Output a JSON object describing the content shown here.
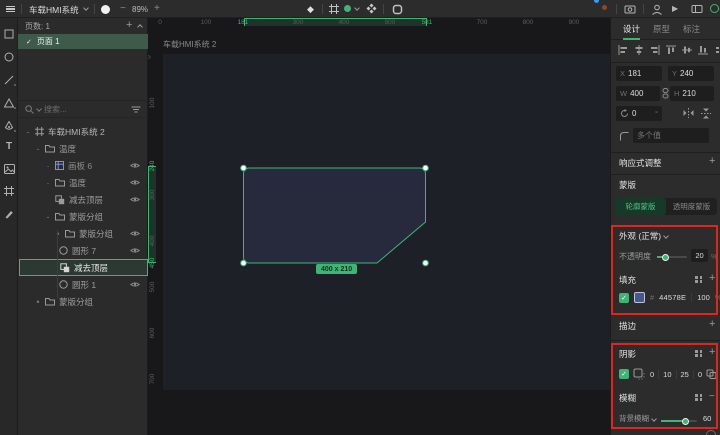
{
  "topbar": {
    "title": "车载HMI系统",
    "zoom_level": "89%"
  },
  "pages": {
    "header": "页数: 1",
    "page1": "页面 1"
  },
  "search_placeholder": "搜索...",
  "layers": [
    {
      "name": "车载HMI系统 2"
    },
    {
      "name": "温度"
    },
    {
      "name": "画板 6"
    },
    {
      "name": "温度"
    },
    {
      "name": "减去顶层"
    },
    {
      "name": "蒙版分组"
    },
    {
      "name": "蒙版分组"
    },
    {
      "name": "圆形 7"
    },
    {
      "name": "减去顶层"
    },
    {
      "name": "圆形 1"
    },
    {
      "name": "蒙版分组"
    }
  ],
  "canvas": {
    "artboard_label": "车载HMI系统 2",
    "size_badge": "400 x 210",
    "ruler_h": [
      "0",
      "100",
      "181",
      "300",
      "400",
      "500",
      "581",
      "700",
      "800",
      "900"
    ],
    "ruler_v": [
      "0",
      "100",
      "240",
      "300",
      "400",
      "450",
      "500",
      "600",
      "700"
    ]
  },
  "inspector": {
    "tabs": {
      "design": "设计",
      "prototype": "原型",
      "inspect": "标注"
    },
    "position": {
      "x_label": "X",
      "x": "181",
      "y_label": "Y",
      "y": "240",
      "w_label": "W",
      "w": "400",
      "h_label": "H",
      "h": "210",
      "rotation": "0",
      "rotation_unit": "°"
    },
    "radius_value": "多个值",
    "responsive_title": "响应式调整",
    "mask": {
      "title": "蒙版",
      "outline": "轮廓蒙版",
      "opacity": "透明度蒙版"
    },
    "appearance": {
      "title": "外观 (正常)",
      "opacity_label": "不透明度",
      "opacity_value": "20",
      "unit": "%"
    },
    "fill": {
      "title": "填充",
      "hash": "#",
      "hex": "44578E",
      "opacity": "100",
      "unit": "%"
    },
    "stroke": {
      "title": "描边"
    },
    "shadow": {
      "title": "阴影",
      "x": "0",
      "y": "10",
      "blur": "25",
      "spread": "0"
    },
    "blur": {
      "title": "模糊",
      "type": "背景模糊",
      "value": "60"
    }
  },
  "colors": {
    "accent": "#3eb575",
    "fill_swatch": "#44578E",
    "annotation_red": "#e1251b"
  }
}
